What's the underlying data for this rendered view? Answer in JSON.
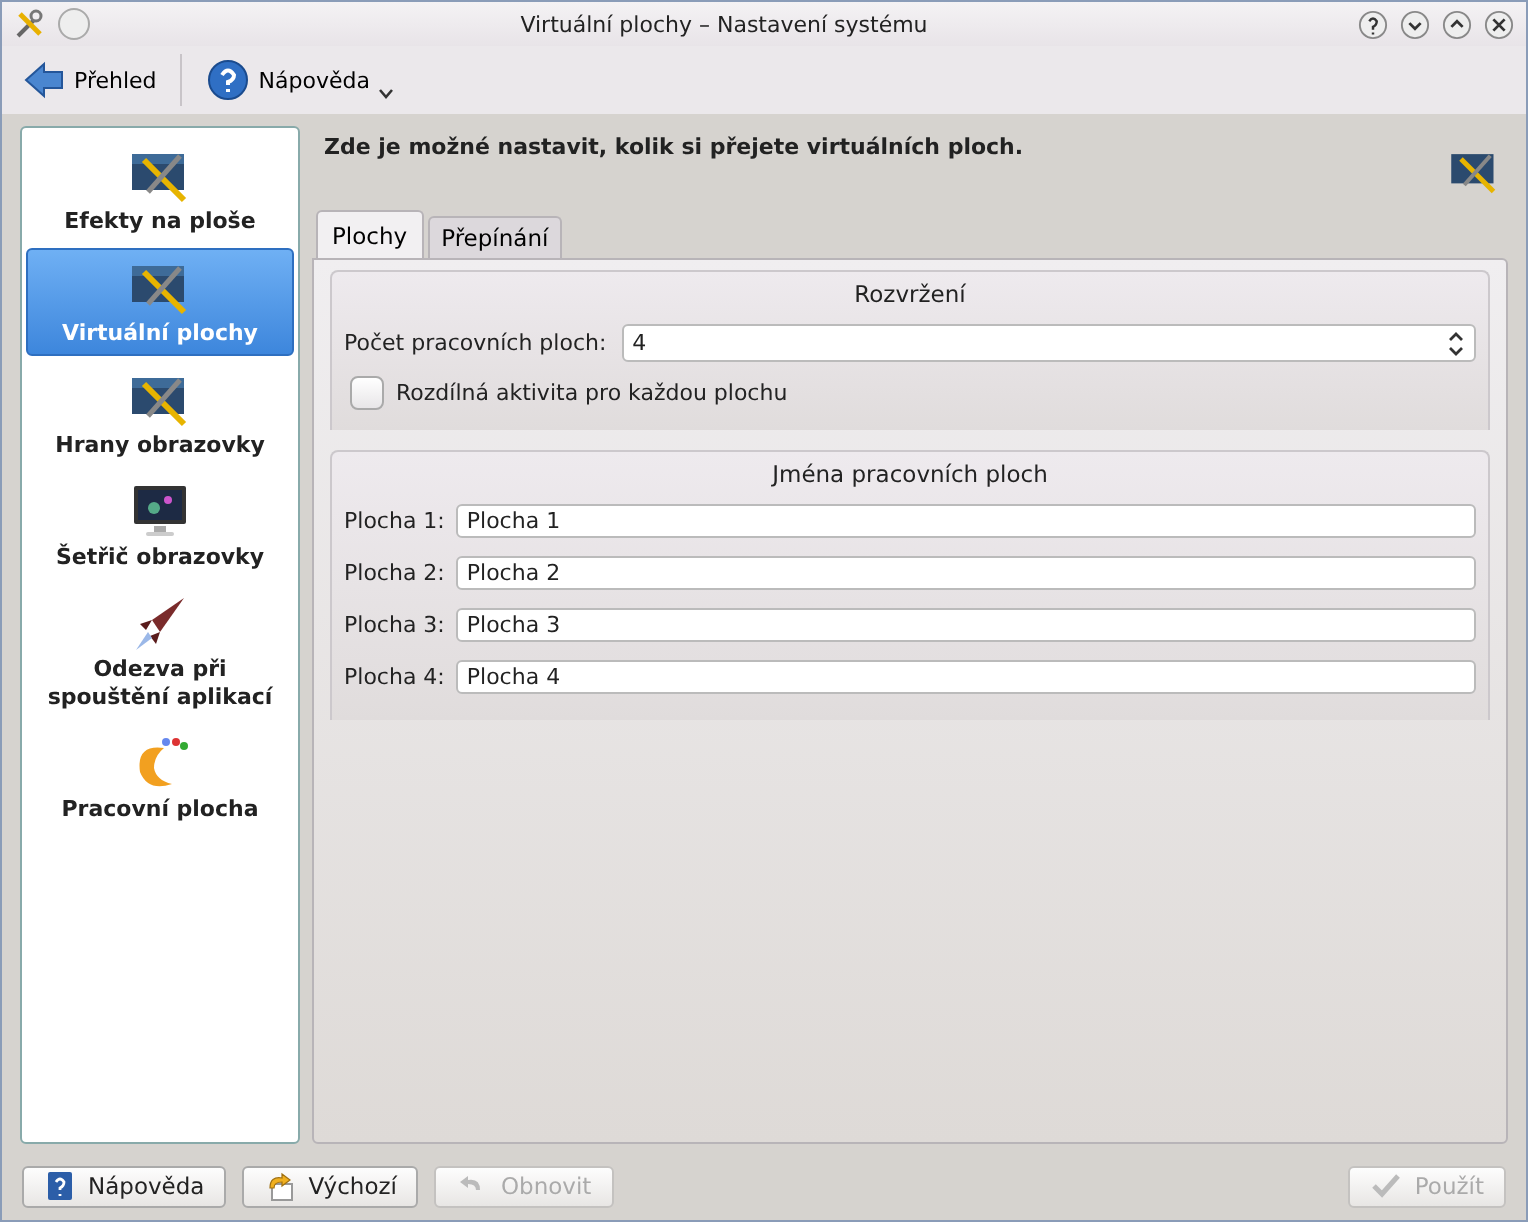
{
  "window": {
    "title": "Virtuální plochy – Nastavení systému"
  },
  "toolbar": [
    {
      "label": "Přehled",
      "kind": "back"
    },
    {
      "label": "Nápověda",
      "kind": "help",
      "menu": true
    }
  ],
  "sidebar": {
    "items": [
      {
        "label": "Efekty na ploše",
        "kind": "tools",
        "selected": false
      },
      {
        "label": "Virtuální plochy",
        "kind": "tools",
        "selected": true
      },
      {
        "label": "Hrany obrazovky",
        "kind": "tools",
        "selected": false
      },
      {
        "label": "Šetřič obrazovky",
        "kind": "monitor",
        "selected": false
      },
      {
        "label": "Odezva při spouštění aplikací",
        "kind": "rocket",
        "selected": false
      },
      {
        "label": "Pracovní plocha",
        "kind": "blob",
        "selected": false
      }
    ]
  },
  "header": "Zde je možné nastavit, kolik si přejete virtuálních ploch.",
  "tabs": [
    {
      "label": "Plochy",
      "selected": true
    },
    {
      "label": "Přepínání",
      "selected": false
    }
  ],
  "layout_group": {
    "title": "Rozvržení",
    "count_label": "Počet pracovních ploch:",
    "count_value": "4",
    "checkbox": {
      "label": "Rozdílná aktivita pro každou plochu",
      "checked": false
    }
  },
  "names_group": {
    "title": "Jména pracovních ploch",
    "rows": [
      {
        "label": "Plocha 1:",
        "value": "Plocha 1"
      },
      {
        "label": "Plocha 2:",
        "value": "Plocha 2"
      },
      {
        "label": "Plocha 3:",
        "value": "Plocha 3"
      },
      {
        "label": "Plocha 4:",
        "value": "Plocha 4"
      }
    ]
  },
  "buttons": [
    {
      "label": "Nápověda",
      "kind": "help",
      "disabled": false
    },
    {
      "label": "Výchozí",
      "kind": "default",
      "disabled": false
    },
    {
      "label": "Obnovit",
      "kind": "reset",
      "disabled": true
    },
    {
      "label": "Použít",
      "kind": "apply",
      "disabled": true
    }
  ]
}
